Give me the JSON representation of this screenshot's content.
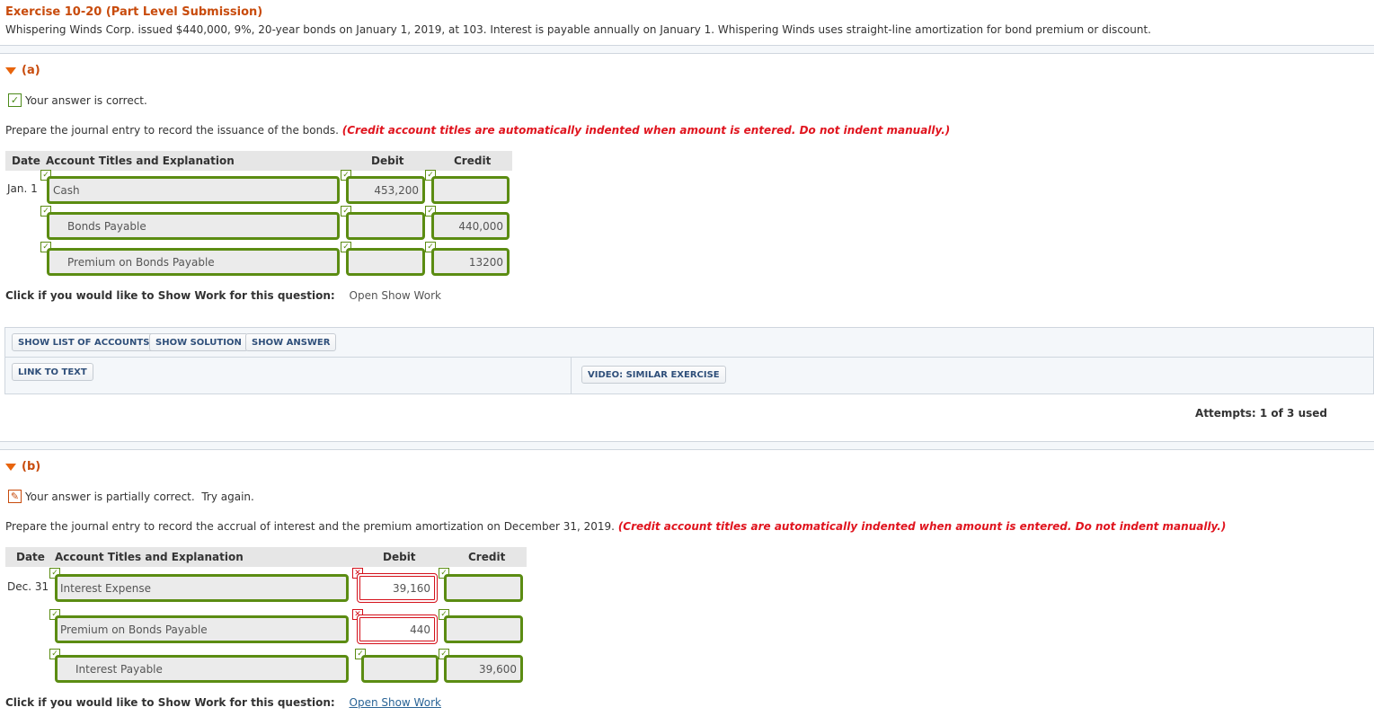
{
  "exercise": {
    "title": "Exercise 10-20 (Part Level Submission)",
    "description": "Whispering Winds Corp. issued $440,000, 9%, 20-year bonds on January 1, 2019, at 103. Interest is payable annually on January 1. Whispering Winds uses straight-line amortization for bond premium or discount."
  },
  "colors": {
    "accent": "#c84b0c",
    "correct": "#5b8c12",
    "incorrect": "#d4101a",
    "instruction": "#e0141e"
  },
  "table_headers": {
    "date": "Date",
    "account": "Account Titles and Explanation",
    "debit": "Debit",
    "credit": "Credit"
  },
  "part_a": {
    "label": "(a)",
    "status_icon": "check-icon",
    "status": "Your answer is correct.",
    "prompt": "Prepare the journal entry to record the issuance of the bonds.",
    "instruction": "(Credit account titles are automatically indented when amount is entered. Do not indent manually.)",
    "rows": [
      {
        "date": "Jan. 1",
        "account": "Cash",
        "debit": "453,200",
        "credit": "",
        "account_ok": true,
        "debit_ok": true,
        "credit_ok": true
      },
      {
        "date": "",
        "account": "Bonds Payable",
        "debit": "",
        "credit": "440,000",
        "account_ok": true,
        "debit_ok": true,
        "credit_ok": true
      },
      {
        "date": "",
        "account": "Premium on Bonds Payable",
        "debit": "",
        "credit": "13200",
        "account_ok": true,
        "debit_ok": true,
        "credit_ok": true
      }
    ],
    "show_work_label": "Click if you would like to Show Work for this question:",
    "show_work_link": "Open Show Work",
    "buttons": {
      "show_list": "SHOW LIST OF ACCOUNTS",
      "show_solution": "SHOW SOLUTION",
      "show_answer": "SHOW ANSWER",
      "link_to_text": "LINK TO TEXT",
      "video": "VIDEO: SIMILAR EXERCISE"
    },
    "attempts": "Attempts: 1 of 3 used"
  },
  "part_b": {
    "label": "(b)",
    "status_icon": "pencil-icon",
    "status": "Your answer is partially correct.  Try again.",
    "prompt": "Prepare the journal entry to record the accrual of interest and the premium amortization on December 31, 2019.",
    "instruction": "(Credit account titles are automatically indented when amount is entered. Do not indent manually.)",
    "rows": [
      {
        "date": "Dec. 31",
        "account": "Interest Expense",
        "debit": "39,160",
        "credit": "",
        "account_ok": true,
        "debit_ok": false,
        "credit_ok": true
      },
      {
        "date": "",
        "account": "Premium on Bonds Payable",
        "debit": "440",
        "credit": "",
        "account_ok": true,
        "debit_ok": false,
        "credit_ok": true
      },
      {
        "date": "",
        "account": "Interest Payable",
        "debit": "",
        "credit": "39,600",
        "account_ok": true,
        "debit_ok": true,
        "credit_ok": true
      }
    ],
    "show_work_label": "Click if you would like to Show Work for this question:",
    "show_work_link": "Open Show Work"
  }
}
